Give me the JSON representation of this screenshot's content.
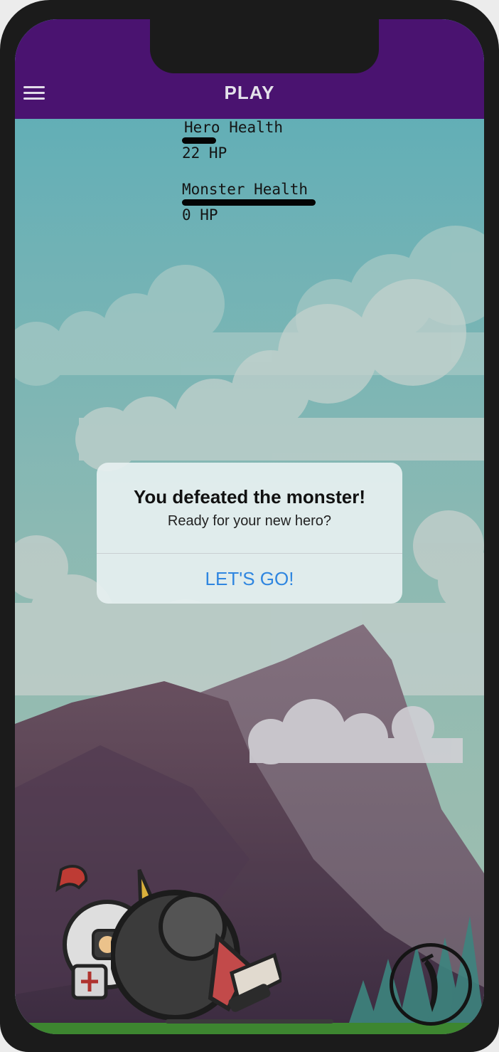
{
  "header": {
    "title": "PLAY",
    "menu_icon": "hamburger-menu-icon"
  },
  "stats": {
    "hero": {
      "label": "Hero Health",
      "value": "22 HP"
    },
    "monster": {
      "label": "Monster Health",
      "value": "0 HP"
    }
  },
  "dialog": {
    "title": "You defeated the monster!",
    "message": "Ready for your new hero?",
    "button_label": "LET'S GO!"
  },
  "controls": {
    "attack_icon": "sword-icon"
  },
  "colors": {
    "header_bg": "#4a1370",
    "button_text": "#2f86e0",
    "sky": "#5fb4bd"
  }
}
